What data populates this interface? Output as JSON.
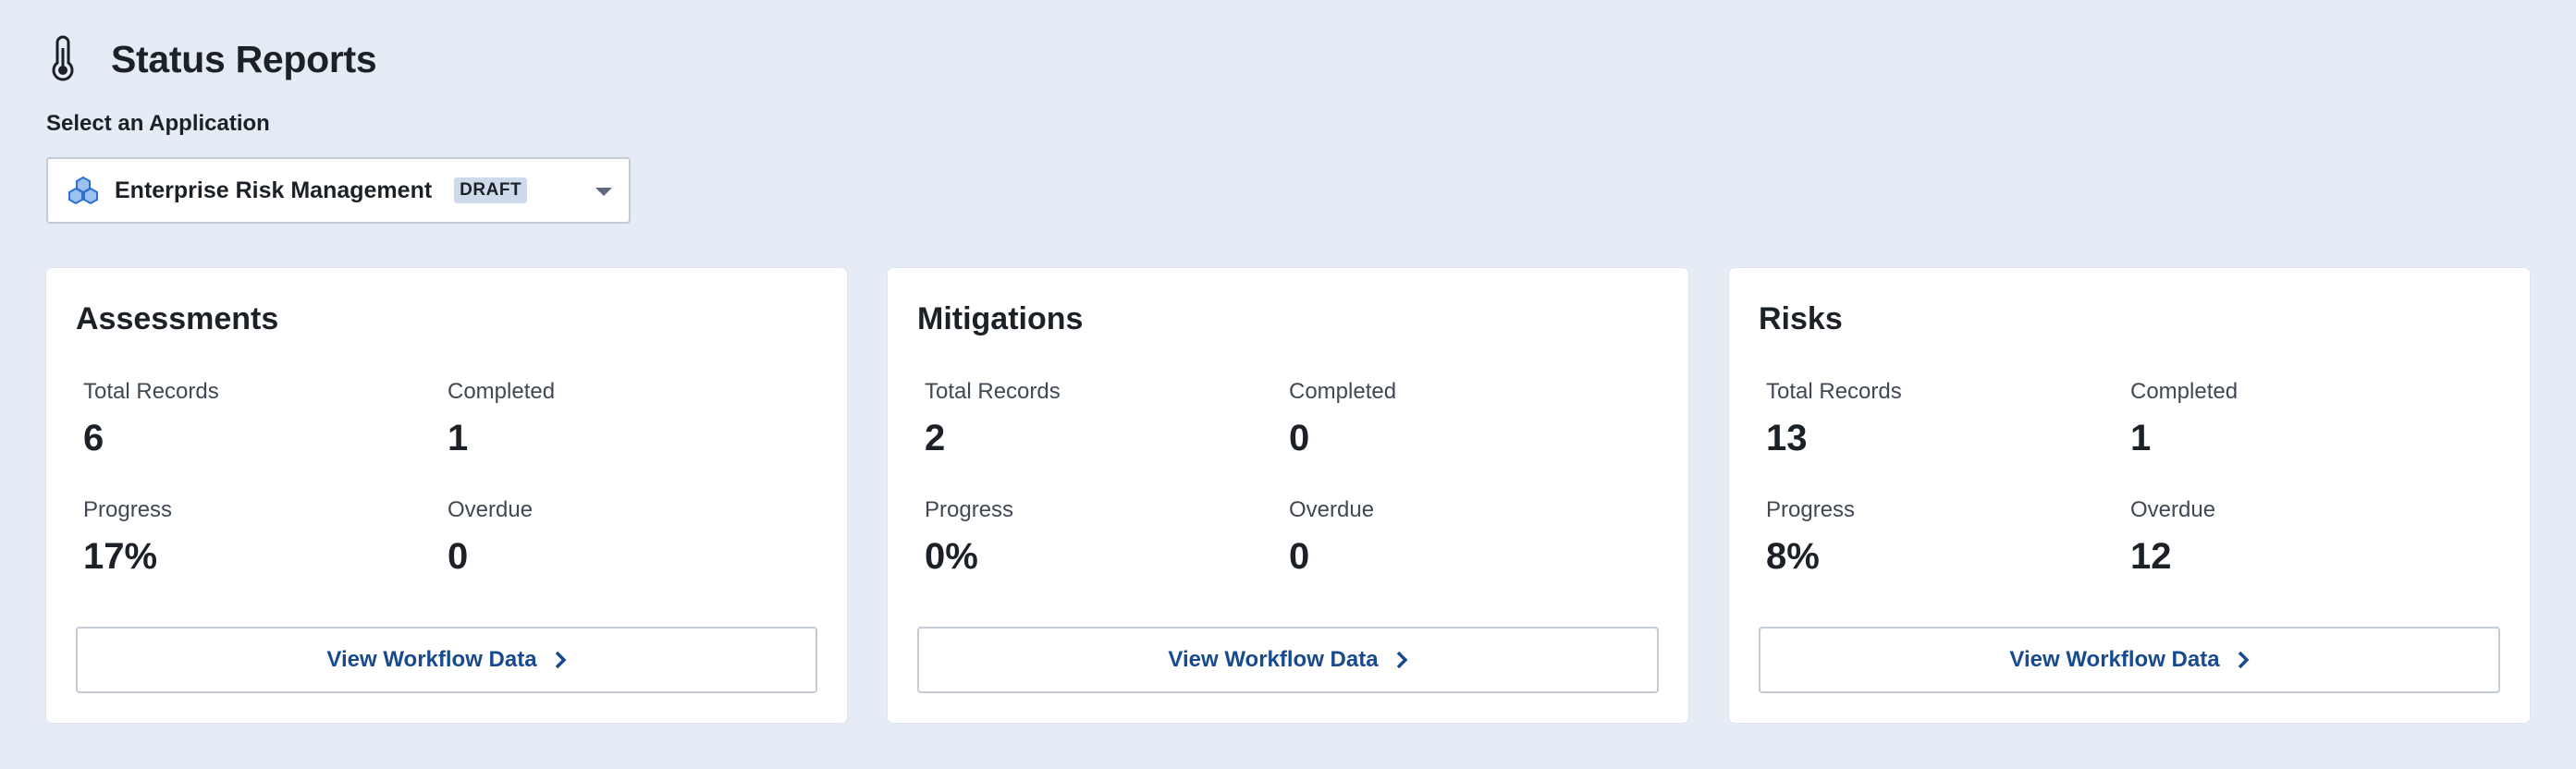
{
  "header": {
    "title": "Status Reports",
    "icon": "thermometer-icon"
  },
  "selector": {
    "label": "Select an Application",
    "app_name": "Enterprise Risk Management",
    "badge": "DRAFT",
    "icon": "cubes-icon"
  },
  "colors": {
    "background": "#e6ecf5",
    "link": "#184a90",
    "badge_bg": "#cfd9ec",
    "app_icon": "#2d72d2"
  },
  "cards": [
    {
      "title": "Assessments",
      "total_label": "Total Records",
      "total": "6",
      "completed_label": "Completed",
      "completed": "1",
      "progress_label": "Progress",
      "progress": "17%",
      "overdue_label": "Overdue",
      "overdue": "0",
      "button": "View Workflow Data"
    },
    {
      "title": "Mitigations",
      "total_label": "Total Records",
      "total": "2",
      "completed_label": "Completed",
      "completed": "0",
      "progress_label": "Progress",
      "progress": "0%",
      "overdue_label": "Overdue",
      "overdue": "0",
      "button": "View Workflow Data"
    },
    {
      "title": "Risks",
      "total_label": "Total Records",
      "total": "13",
      "completed_label": "Completed",
      "completed": "1",
      "progress_label": "Progress",
      "progress": "8%",
      "overdue_label": "Overdue",
      "overdue": "12",
      "button": "View Workflow Data"
    }
  ]
}
